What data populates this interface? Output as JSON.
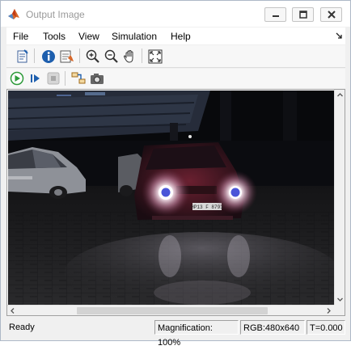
{
  "window": {
    "title": "Output Image",
    "controls": {
      "minimize": "minimize-icon",
      "maximize": "maximize-icon",
      "close": "close-icon"
    }
  },
  "menubar": {
    "items": [
      "File",
      "Tools",
      "View",
      "Simulation",
      "Help"
    ]
  },
  "toolbar": {
    "buttons": [
      "print-to-figure-icon",
      "info-icon",
      "matlab-export-icon",
      "zoom-in-icon",
      "zoom-out-icon",
      "pan-hand-icon",
      "fit-to-view-icon"
    ]
  },
  "simulation_toolbar": {
    "buttons": [
      "run-icon",
      "step-forward-icon",
      "stop-icon",
      "highlight-block-icon",
      "snapshot-icon"
    ]
  },
  "image": {
    "description_none": "",
    "license_plate": "HP13 F 8791",
    "markers": 2
  },
  "statusbar": {
    "status": "Ready",
    "magnification": "Magnification: 100%",
    "format": "RGB:480x640",
    "time": "T=0.000"
  },
  "colors": {
    "marker": "#4a55d8",
    "run_green": "#2e9b3a",
    "accent_blue": "#1e5fae"
  }
}
